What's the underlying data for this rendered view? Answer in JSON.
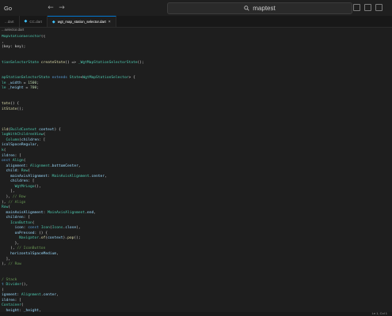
{
  "titlebar": {
    "menu_go": "Go",
    "back_arrow": "←",
    "forward_arrow": "→",
    "search_value": "maptest"
  },
  "tabs": [
    {
      "label": "...dart",
      "active": false
    },
    {
      "label": "CC.dart",
      "active": false
    },
    {
      "label": "wgt_map_station_selector.dart",
      "active": true
    }
  ],
  "breadcrumb": "...selector.dart",
  "code_lines": [
    [
      {
        "t": "MapStationSelector",
        "k": "cls"
      },
      {
        "t": "({",
        "k": "pl"
      }
    ],
    [
      {
        "t": ",",
        "k": "pl"
      }
    ],
    [
      {
        "t": "(key: key);",
        "k": "pl"
      }
    ],
    [],
    [],
    [
      {
        "t": "tionSelectorState ",
        "k": "cls"
      },
      {
        "t": "createState",
        "k": "fn"
      },
      {
        "t": "() => ",
        "k": "pl"
      },
      {
        "t": "_WgtMapStationSelectorState",
        "k": "cls"
      },
      {
        "t": "();",
        "k": "pl"
      }
    ],
    [],
    [],
    [
      {
        "t": "apStationSelectorState ",
        "k": "cls"
      },
      {
        "t": "extends ",
        "k": "kw"
      },
      {
        "t": "State",
        "k": "cls"
      },
      {
        "t": "<",
        "k": "pl"
      },
      {
        "t": "WgtMapStationSelector",
        "k": "cls"
      },
      {
        "t": "> {",
        "k": "pl"
      }
    ],
    [
      {
        "t": "le ",
        "k": "cls"
      },
      {
        "t": "_width",
        "k": "var"
      },
      {
        "t": " = ",
        "k": "pl"
      },
      {
        "t": "1500",
        "k": "num"
      },
      {
        "t": ";",
        "k": "pl"
      }
    ],
    [
      {
        "t": "le ",
        "k": "cls"
      },
      {
        "t": "_height",
        "k": "var"
      },
      {
        "t": " = ",
        "k": "pl"
      },
      {
        "t": "700",
        "k": "num"
      },
      {
        "t": ";",
        "k": "pl"
      }
    ],
    [],
    [],
    [
      {
        "t": "tate",
        "k": "fn"
      },
      {
        "t": "() {",
        "k": "pl"
      }
    ],
    [
      {
        "t": "itState",
        "k": "fn"
      },
      {
        "t": "();",
        "k": "pl"
      }
    ],
    [],
    [],
    [],
    [
      {
        "t": "ild",
        "k": "fn"
      },
      {
        "t": "(",
        "k": "pl"
      },
      {
        "t": "BuildContext ",
        "k": "cls"
      },
      {
        "t": "context",
        "k": "var"
      },
      {
        "t": ") {",
        "k": "pl"
      }
    ],
    [
      {
        "t": "logWithChildrenView",
        "k": "cls"
      },
      {
        "t": "(",
        "k": "pl"
      }
    ],
    [
      {
        "t": "  Column",
        "k": "cls"
      },
      {
        "t": "(",
        "k": "pl"
      },
      {
        "t": "children",
        "k": "var"
      },
      {
        "t": ": [",
        "k": "pl"
      }
    ],
    [
      {
        "t": "icalSpaceRegular",
        "k": "var"
      },
      {
        "t": ",",
        "k": "pl"
      }
    ],
    [
      {
        "t": "k",
        "k": "cls"
      },
      {
        "t": "(",
        "k": "pl"
      }
    ],
    [
      {
        "t": "ildren",
        "k": "var"
      },
      {
        "t": ": [",
        "k": "pl"
      }
    ],
    [
      {
        "t": "onst ",
        "k": "kw"
      },
      {
        "t": "Align",
        "k": "cls"
      },
      {
        "t": "(",
        "k": "pl"
      }
    ],
    [
      {
        "t": "  alignment",
        "k": "var"
      },
      {
        "t": ": ",
        "k": "pl"
      },
      {
        "t": "Alignment",
        "k": "cls"
      },
      {
        "t": ".",
        "k": "pl"
      },
      {
        "t": "bottomCenter",
        "k": "var"
      },
      {
        "t": ",",
        "k": "pl"
      }
    ],
    [
      {
        "t": "  child",
        "k": "var"
      },
      {
        "t": ": ",
        "k": "pl"
      },
      {
        "t": "Row",
        "k": "cls"
      },
      {
        "t": "(",
        "k": "pl"
      }
    ],
    [
      {
        "t": "    mainAxisAlignment",
        "k": "var"
      },
      {
        "t": ": ",
        "k": "pl"
      },
      {
        "t": "MainAxisAlignment",
        "k": "cls"
      },
      {
        "t": ".",
        "k": "pl"
      },
      {
        "t": "center",
        "k": "var"
      },
      {
        "t": ",",
        "k": "pl"
      }
    ],
    [
      {
        "t": "    children",
        "k": "var"
      },
      {
        "t": ": [",
        "k": "pl"
      }
    ],
    [
      {
        "t": "      WgtMrLogo",
        "k": "cls"
      },
      {
        "t": "(),",
        "k": "pl"
      }
    ],
    [
      {
        "t": "    ],",
        "k": "pl"
      }
    ],
    [
      {
        "t": "  ), ",
        "k": "pl"
      },
      {
        "t": "// Row",
        "k": "cmt"
      }
    ],
    [
      {
        "t": "), ",
        "k": "pl"
      },
      {
        "t": "// Align",
        "k": "cmt"
      }
    ],
    [
      {
        "t": "Row",
        "k": "cls"
      },
      {
        "t": "(",
        "k": "pl"
      }
    ],
    [
      {
        "t": "  mainAxisAlignment",
        "k": "var"
      },
      {
        "t": ": ",
        "k": "pl"
      },
      {
        "t": "MainAxisAlignment",
        "k": "cls"
      },
      {
        "t": ".",
        "k": "pl"
      },
      {
        "t": "end",
        "k": "var"
      },
      {
        "t": ",",
        "k": "pl"
      }
    ],
    [
      {
        "t": "  children",
        "k": "var"
      },
      {
        "t": ": [",
        "k": "pl"
      }
    ],
    [
      {
        "t": "    IconButton",
        "k": "cls"
      },
      {
        "t": "(",
        "k": "pl"
      }
    ],
    [
      {
        "t": "      icon",
        "k": "var"
      },
      {
        "t": ": ",
        "k": "pl"
      },
      {
        "t": "const ",
        "k": "kw"
      },
      {
        "t": "Icon",
        "k": "cls"
      },
      {
        "t": "(",
        "k": "pl"
      },
      {
        "t": "Icons",
        "k": "cls"
      },
      {
        "t": ".",
        "k": "pl"
      },
      {
        "t": "close",
        "k": "var"
      },
      {
        "t": "),",
        "k": "pl"
      }
    ],
    [
      {
        "t": "      onPressed",
        "k": "var"
      },
      {
        "t": ": () {",
        "k": "pl"
      }
    ],
    [
      {
        "t": "        Navigator",
        "k": "cls"
      },
      {
        "t": ".",
        "k": "pl"
      },
      {
        "t": "of",
        "k": "fn"
      },
      {
        "t": "(",
        "k": "pl"
      },
      {
        "t": "context",
        "k": "var"
      },
      {
        "t": ").",
        "k": "pl"
      },
      {
        "t": "pop",
        "k": "fn"
      },
      {
        "t": "();",
        "k": "pl"
      }
    ],
    [
      {
        "t": "      },",
        "k": "pl"
      }
    ],
    [
      {
        "t": "    ), ",
        "k": "pl"
      },
      {
        "t": "// IconButton",
        "k": "cmt"
      }
    ],
    [
      {
        "t": "    horizontalSpaceMedium",
        "k": "var"
      },
      {
        "t": ",",
        "k": "pl"
      }
    ],
    [
      {
        "t": "  ],",
        "k": "pl"
      }
    ],
    [
      {
        "t": "), ",
        "k": "pl"
      },
      {
        "t": "// Row",
        "k": "cmt"
      }
    ],
    [],
    [],
    [
      {
        "t": "/ Stack",
        "k": "cmt"
      }
    ],
    [
      {
        "t": "t ",
        "k": "kw"
      },
      {
        "t": "Divider",
        "k": "cls"
      },
      {
        "t": "(),",
        "k": "pl"
      }
    ],
    [
      {
        "t": "(",
        "k": "pl"
      }
    ],
    [
      {
        "t": "ignment",
        "k": "var"
      },
      {
        "t": ": ",
        "k": "pl"
      },
      {
        "t": "Alignment",
        "k": "cls"
      },
      {
        "t": ".",
        "k": "pl"
      },
      {
        "t": "center",
        "k": "var"
      },
      {
        "t": ",",
        "k": "pl"
      }
    ],
    [
      {
        "t": "ildren",
        "k": "var"
      },
      {
        "t": ": [",
        "k": "pl"
      }
    ],
    [
      {
        "t": "Container",
        "k": "cls"
      },
      {
        "t": "(",
        "k": "pl"
      }
    ],
    [
      {
        "t": "  height",
        "k": "var"
      },
      {
        "t": ": ",
        "k": "pl"
      },
      {
        "t": "_height",
        "k": "var"
      },
      {
        "t": ",",
        "k": "pl"
      }
    ],
    [
      {
        "t": "  width",
        "k": "var"
      },
      {
        "t": ": ",
        "k": "pl"
      },
      {
        "t": "_width",
        "k": "var"
      },
      {
        "t": ",",
        "k": "pl"
      }
    ],
    [
      {
        "t": "  ",
        "k": "pl"
      }
    ]
  ],
  "status": {
    "position": "Ln 1, Col 1"
  }
}
